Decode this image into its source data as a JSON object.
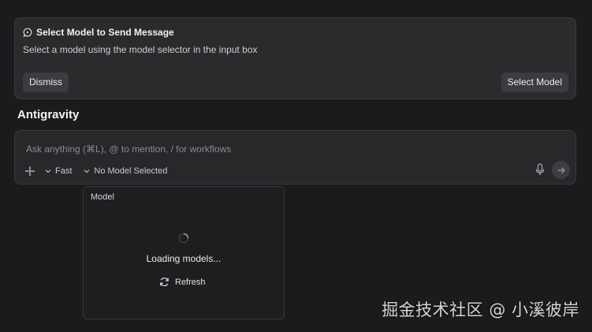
{
  "notice": {
    "title": "Select Model to Send Message",
    "description": "Select a model using the model selector in the input box",
    "dismiss_label": "Dismiss",
    "select_model_label": "Select Model",
    "icon": "chat-bubble-icon"
  },
  "page": {
    "title": "Antigravity"
  },
  "composer": {
    "placeholder": "Ask anything (⌘L), @ to mention, / for workflows",
    "value": "",
    "mode_label": "Fast",
    "model_label": "No Model Selected",
    "icons": [
      "plus-icon",
      "chevron-down-icon",
      "mic-icon",
      "arrow-right-icon"
    ]
  },
  "model_panel": {
    "label": "Model",
    "loading_text": "Loading models...",
    "refresh_label": "Refresh",
    "icons": [
      "spinner-icon",
      "refresh-icon"
    ]
  },
  "watermark": "掘金技术社区 @ 小溪彼岸"
}
